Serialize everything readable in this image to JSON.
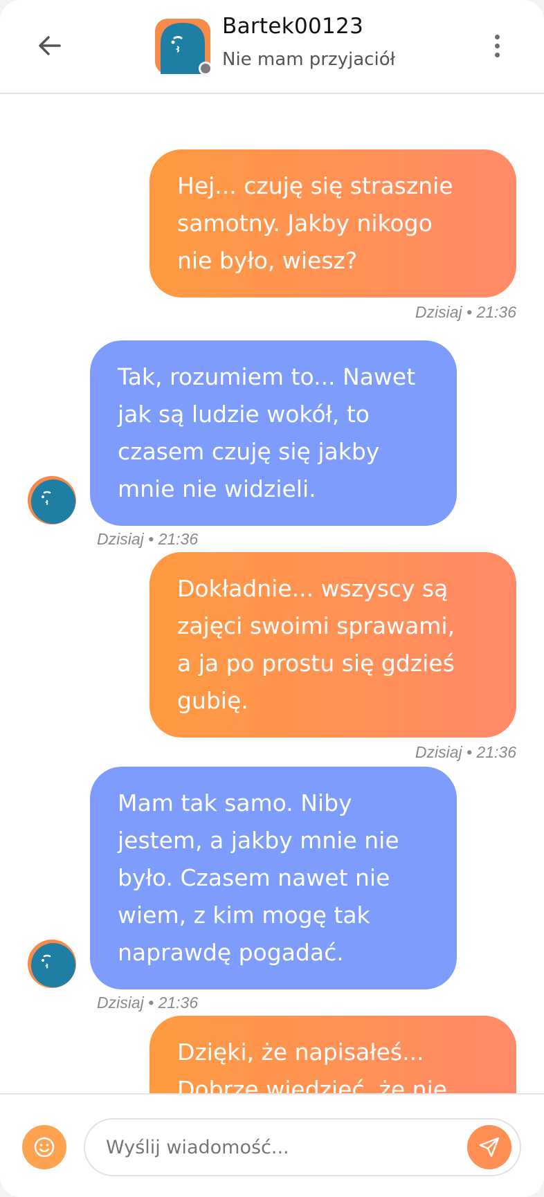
{
  "header": {
    "contact_name": "Bartek00123",
    "contact_status": "Nie mam przyjaciół",
    "presence": "offline",
    "icons": [
      "arrow-left-icon",
      "more-vertical-icon"
    ]
  },
  "colors": {
    "outgoing_gradient_start": "#ff9a40",
    "outgoing_gradient_end": "#ff8a68",
    "incoming": "#7d9cfc",
    "avatar_bg": "#1f7ea3",
    "avatar_accent": "#f58a4a"
  },
  "messages": [
    {
      "direction": "out",
      "text": "Hej... czuję się strasznie\nsamotny. Jakby nikogo\nnie było, wiesz?",
      "time": "Dzisiaj • 21:36"
    },
    {
      "direction": "in",
      "text": "Tak, rozumiem to... Nawet\njak są ludzie wokół, to\nczasem czuję się jakby\nmnie nie widzieli.",
      "time": "Dzisiaj • 21:36"
    },
    {
      "direction": "out",
      "text": "Dokładnie... wszyscy są\nzajęci swoimi sprawami,\na ja po prostu się gdzieś\ngubię.",
      "time": "Dzisiaj • 21:36"
    },
    {
      "direction": "in",
      "text": "Mam tak samo. Niby\njestem, a jakby mnie nie\nbyło. Czasem nawet nie\nwiem, z kim mogę tak\nnaprawdę pogadać.",
      "time": "Dzisiaj • 21:36"
    },
    {
      "direction": "out",
      "text": "Dzięki, że napisałeś...\nDobrze wiedzieć, że nie",
      "time": ""
    }
  ],
  "composer": {
    "placeholder": "Wyślij wiadomość...",
    "icons": [
      "smile-icon",
      "send-icon"
    ]
  }
}
